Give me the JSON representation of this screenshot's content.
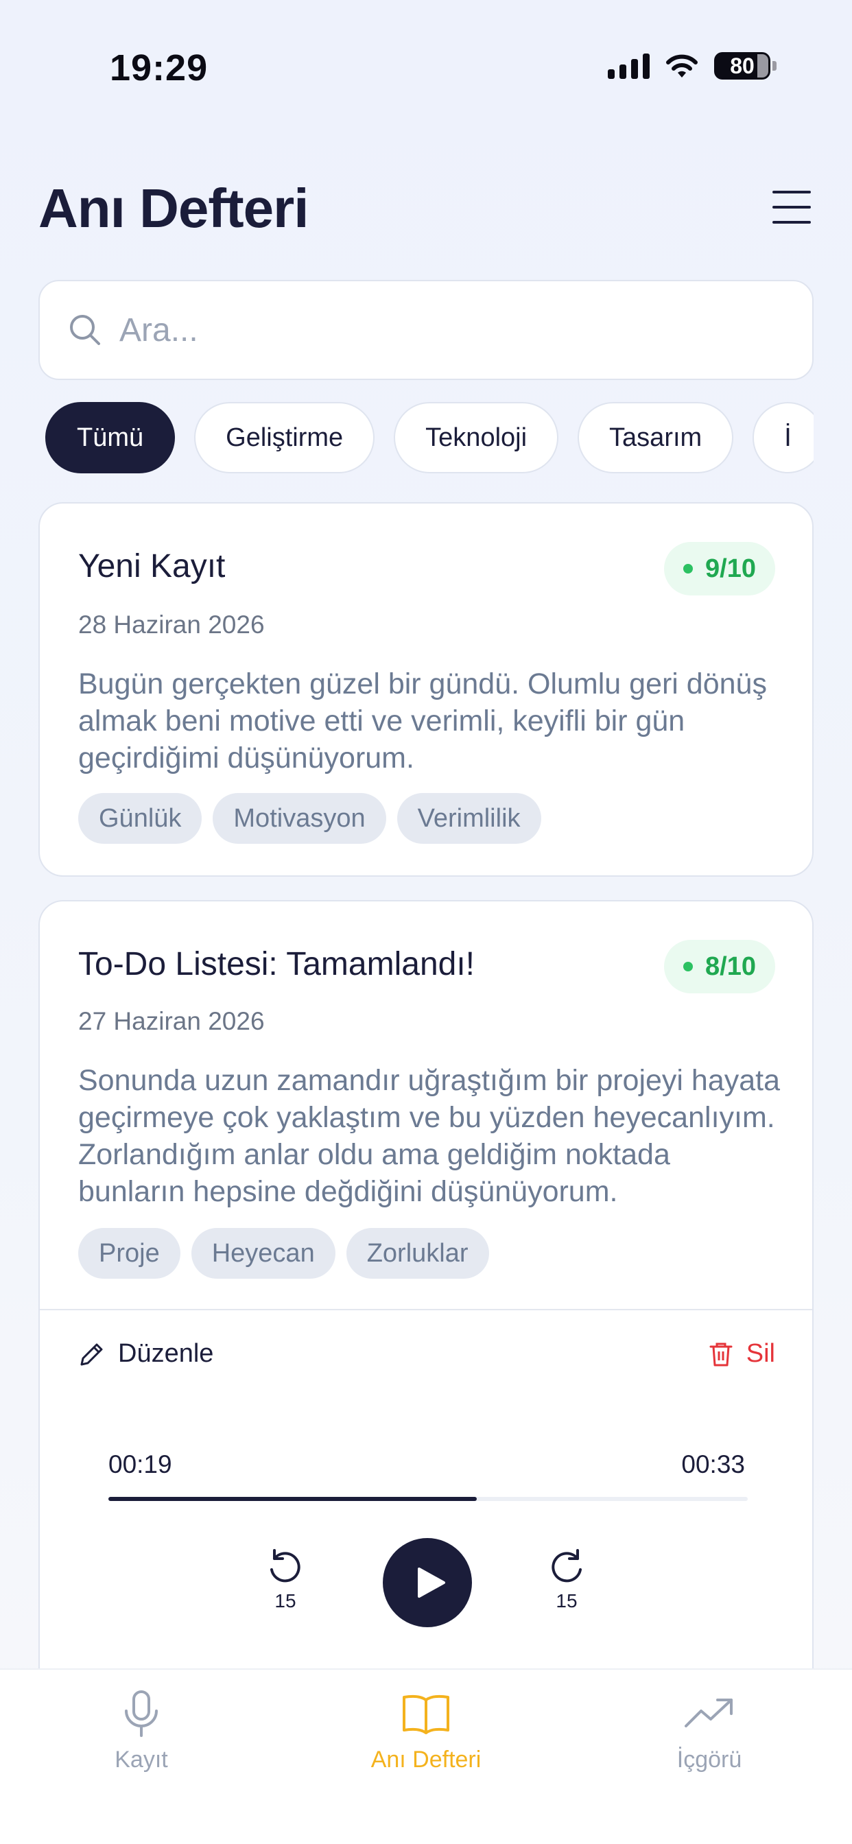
{
  "status_bar": {
    "time": "19:29",
    "battery": "80"
  },
  "header": {
    "title": "Anı Defteri"
  },
  "search": {
    "placeholder": "Ara..."
  },
  "filters": [
    "Tümü",
    "Geliştirme",
    "Teknoloji",
    "Tasarım",
    "İ"
  ],
  "entries": [
    {
      "title": "Yeni Kayıt",
      "score": "9/10",
      "date": "28 Haziran 2026",
      "text": "Bugün gerçekten güzel bir gündü. Olumlu geri dönüş almak beni motive etti ve verimli, keyifli bir gün geçirdiğimi düşünüyorum.",
      "tags": [
        "Günlük",
        "Motivasyon",
        "Verimlilik"
      ]
    },
    {
      "title": "To-Do Listesi: Tamamlandı!",
      "score": "8/10",
      "date": "27 Haziran 2026",
      "text": "Sonunda uzun zamandır uğraştığım bir projeyi hayata geçirmeye çok yaklaştım ve bu yüzden heyecanlıyım. Zorlandığım anlar oldu ama geldiğim noktada bunların hepsine değdiğini düşünüyorum.",
      "tags": [
        "Proje",
        "Heyecan",
        "Zorluklar"
      ],
      "actions": {
        "edit": "Düzenle",
        "delete": "Sil"
      },
      "player": {
        "current": "00:19",
        "total": "00:33",
        "progress": 0.576,
        "skip_back": "15",
        "skip_forward": "15"
      }
    }
  ],
  "nav": {
    "record": "Kayıt",
    "diary": "Anı Defteri",
    "insight": "İçgörü"
  },
  "colors": {
    "primary": "#1b1d3a",
    "accent": "#f4b21d",
    "score_green": "#20a851",
    "delete_red": "#e5343a"
  },
  "icons": {
    "status": [
      "cellular-signal-icon",
      "wifi-icon",
      "battery-icon"
    ],
    "header": "menu-icon",
    "search": "search-icon",
    "entry_actions": [
      "pencil-icon",
      "trash-icon"
    ],
    "player": [
      "rewind-15-icon",
      "play-icon",
      "forward-15-icon"
    ],
    "nav": [
      "microphone-icon",
      "book-icon",
      "trending-up-icon"
    ]
  }
}
